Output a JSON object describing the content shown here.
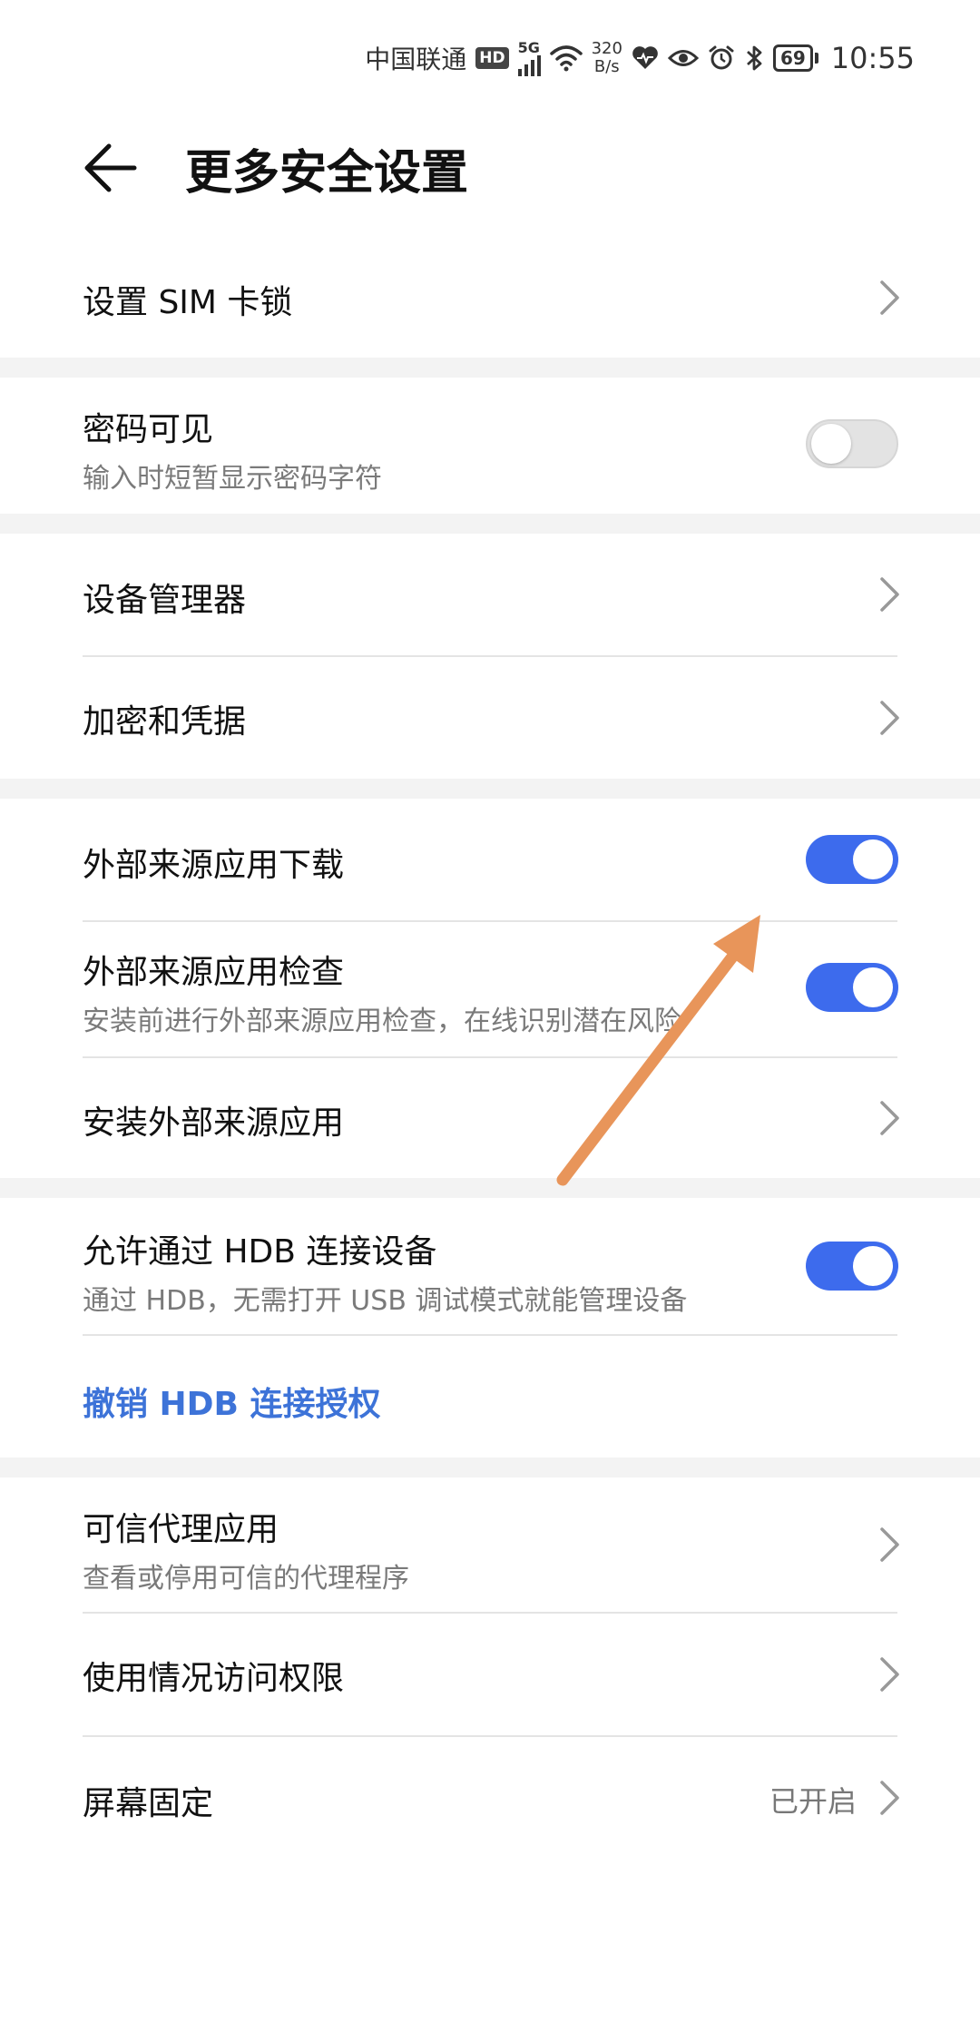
{
  "status_bar": {
    "carrier": "中国联通",
    "hd_badge": "HD",
    "network": "5G",
    "speed_value": "320",
    "speed_unit": "B/s",
    "battery": "69",
    "time": "10:55",
    "icons": [
      "wifi-icon",
      "heart-rate-icon",
      "eye-icon",
      "alarm-icon",
      "bluetooth-icon"
    ]
  },
  "header": {
    "title": "更多安全设置"
  },
  "sim_lock": {
    "label": "设置 SIM 卡锁"
  },
  "password_visible": {
    "label": "密码可见",
    "desc": "输入时短暂显示密码字符",
    "enabled": false
  },
  "device_admin": {
    "label": "设备管理器"
  },
  "encryption": {
    "label": "加密和凭据"
  },
  "external_download": {
    "label": "外部来源应用下载",
    "enabled": true
  },
  "external_check": {
    "label": "外部来源应用检查",
    "desc": "安装前进行外部来源应用检查，在线识别潜在风险",
    "enabled": true
  },
  "install_external": {
    "label": "安装外部来源应用"
  },
  "hdb": {
    "label": "允许通过 HDB 连接设备",
    "desc": "通过 HDB，无需打开 USB 调试模式就能管理设备",
    "enabled": true
  },
  "revoke_hdb": {
    "label": "撤销 HDB 连接授权"
  },
  "trust_agents": {
    "label": "可信代理应用",
    "desc": "查看或停用可信的代理程序"
  },
  "usage_access": {
    "label": "使用情况访问权限"
  },
  "screen_pinning": {
    "label": "屏幕固定",
    "value": "已开启"
  },
  "colors": {
    "accent": "#3d6bed",
    "link": "#3d73d8",
    "arrow": "#e8955a",
    "group_gap": "#f3f3f3"
  }
}
